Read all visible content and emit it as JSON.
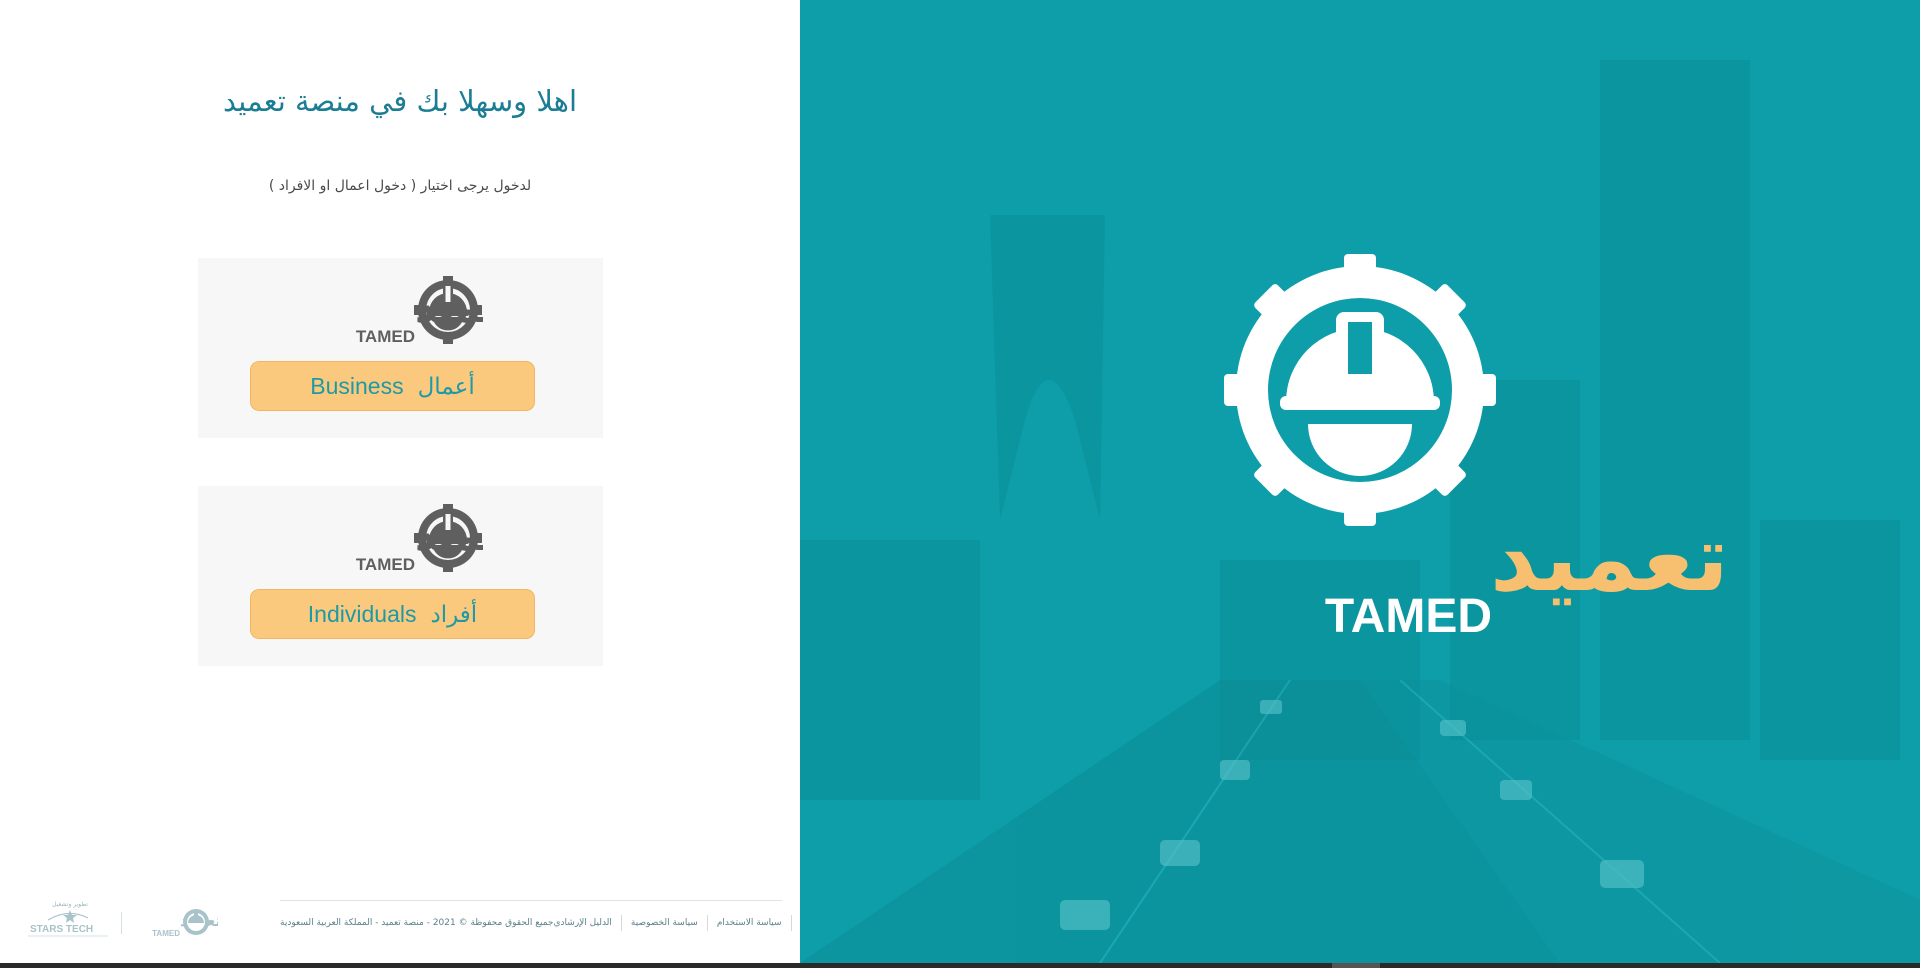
{
  "welcome": {
    "title": "اهلا وسهلا بك في منصة تعميد",
    "instruction": "لدخول يرجى اختيار ( دخول اعمال او الافراد )"
  },
  "brand": {
    "arabic_name": "تعميد",
    "english_name": "TAMED"
  },
  "business_card": {
    "arabic_label": "أعمال",
    "english_label": "Business"
  },
  "individuals_card": {
    "arabic_label": "أفراد",
    "english_label": "Individuals"
  },
  "footer": {
    "copyright": "جميع الحقوق محفوظة © 2021 - منصة تعميد - المملكة العربية السعودية",
    "links": [
      "سياسة الاستخدام",
      "سياسة الخصوصية",
      "الدليل الإرشادي"
    ]
  },
  "footer_logos": {
    "developer_tagline": "تطوير وتشغيل",
    "developer_name": "STARS TECH",
    "platform_name": "TAMED"
  },
  "colors": {
    "teal": "#0e9ea9",
    "title_teal": "#1b7d94",
    "button_orange": "#fbc97d",
    "logo_grey": "#5f5f5f",
    "logo_orange": "#f7c071"
  },
  "icons": {
    "logo": "hardhat-gear-icon"
  }
}
